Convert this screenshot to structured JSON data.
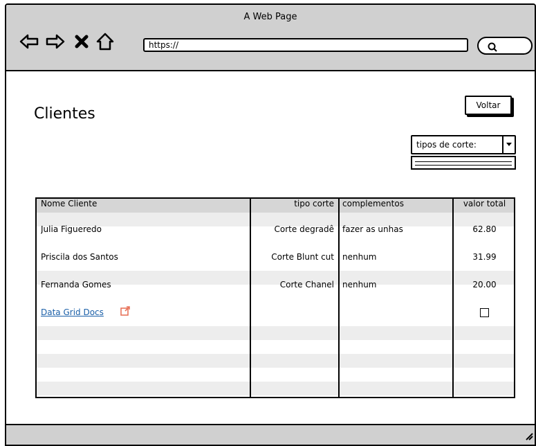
{
  "window": {
    "title": "A Web Page"
  },
  "browser": {
    "url": "https://"
  },
  "page": {
    "title": "Clientes",
    "back_button": "Voltar",
    "filter": {
      "selected": "tipos de corte:"
    }
  },
  "grid": {
    "columns": [
      "Nome Cliente",
      "tipo corte",
      "complementos",
      "valor total"
    ],
    "rows": [
      {
        "nome": "Julia Figueredo",
        "tipo": "Corte degradê",
        "comp": "fazer as unhas",
        "valor": "62.80"
      },
      {
        "nome": "Priscila dos Santos",
        "tipo": "Corte Blunt cut",
        "comp": "nenhum",
        "valor": "31.99"
      },
      {
        "nome": "Fernanda Gomes",
        "tipo": "Corte Chanel",
        "comp": "nenhum",
        "valor": "20.00"
      }
    ],
    "link_text": "Data Grid Docs"
  },
  "colors": {
    "chrome": "#d0d0d0",
    "link": "#1a5fa8",
    "ext_icon": "#e8735a"
  }
}
